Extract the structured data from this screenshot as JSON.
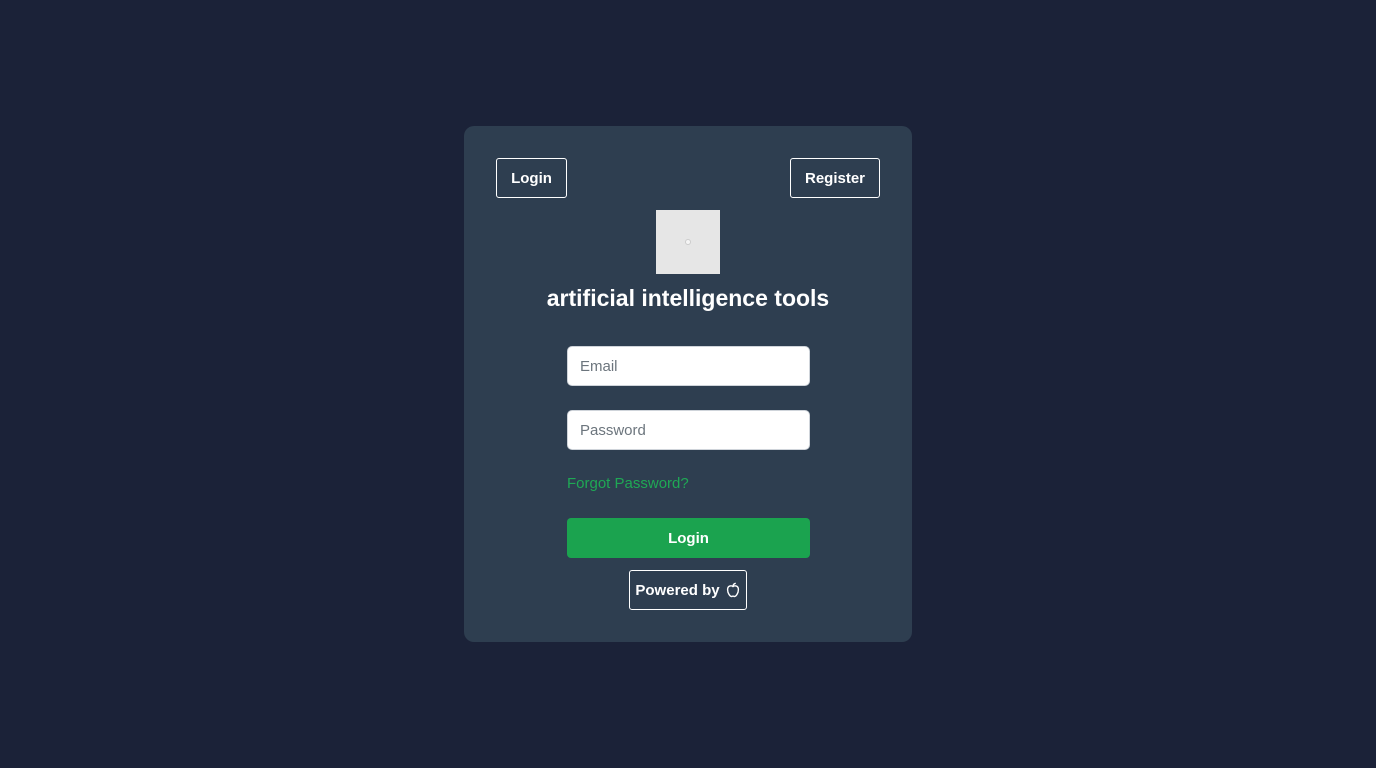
{
  "nav": {
    "login_label": "Login",
    "register_label": "Register"
  },
  "brand": {
    "title": "artificial intelligence tools",
    "logo_icon": "placeholder-image-icon"
  },
  "form": {
    "email_placeholder": "Email",
    "email_value": "",
    "password_placeholder": "Password",
    "password_value": "",
    "forgot_label": "Forgot Password?",
    "submit_label": "Login"
  },
  "footer": {
    "powered_label": "Powered by",
    "powered_icon": "apple-logo-icon"
  },
  "colors": {
    "page_background": "#1b2238",
    "card_background": "#2e3e50",
    "accent_green": "#1ba34f",
    "link_green": "#1fa855"
  }
}
